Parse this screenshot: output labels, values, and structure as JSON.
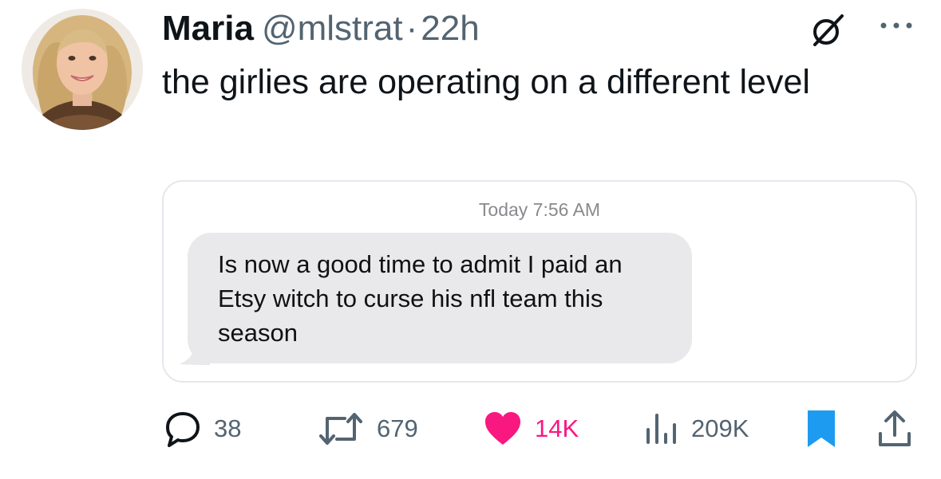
{
  "tweet": {
    "author_name": "Maria",
    "handle": "@mlstrat",
    "separator": "·",
    "time_ago": "22h",
    "text": "the girlies are operating on a different level"
  },
  "media": {
    "timestamp": "Today 7:56 AM",
    "message": "Is now a good time to admit I paid an Etsy witch to curse his nfl team this season"
  },
  "stats": {
    "replies": "38",
    "reposts": "679",
    "likes": "14K",
    "views": "209K"
  },
  "colors": {
    "like": "#f91880",
    "bookmark": "#1d9bf0",
    "secondary_text": "#536471",
    "bubble": "#e9e9eb"
  },
  "icons": {
    "header": [
      "no-entry-icon",
      "more-icon"
    ],
    "actions": [
      "reply-icon",
      "repost-icon",
      "heart-icon",
      "views-icon",
      "bookmark-icon",
      "share-icon"
    ]
  }
}
